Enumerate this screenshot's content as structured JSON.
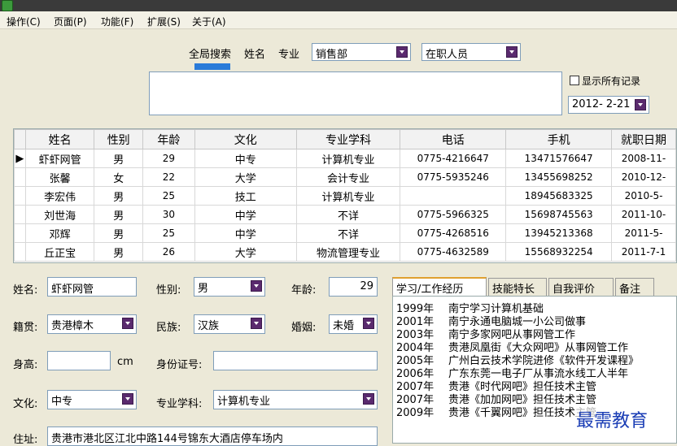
{
  "menu": [
    "操作(C)",
    "页面(P)",
    "功能(F)",
    "扩展(S)",
    "关于(A)"
  ],
  "search": {
    "tab_label": "全局搜索",
    "name_label": "姓名",
    "major_label": "专业",
    "dept_value": "销售部",
    "status_value": "在职人员",
    "show_all_label": "显示所有记录",
    "date_value": "2012- 2-21"
  },
  "table": {
    "columns": [
      "姓名",
      "性别",
      "年龄",
      "文化",
      "专业学科",
      "电话",
      "手机",
      "就职日期"
    ],
    "rows": [
      [
        "虾虾网管",
        "男",
        "29",
        "中专",
        "计算机专业",
        "0775-4216647",
        "13471576647",
        "2008-11-"
      ],
      [
        "张馨",
        "女",
        "22",
        "大学",
        "会计专业",
        "0775-5935246",
        "13455698252",
        "2010-12-"
      ],
      [
        "李宏伟",
        "男",
        "25",
        "技工",
        "计算机专业",
        "",
        "18945683325",
        "2010-5-"
      ],
      [
        "刘世海",
        "男",
        "30",
        "中学",
        "不详",
        "0775-5966325",
        "15698745563",
        "2011-10-"
      ],
      [
        "邓辉",
        "男",
        "25",
        "中学",
        "不详",
        "0775-4268516",
        "13945213368",
        "2011-5-"
      ],
      [
        "丘正宝",
        "男",
        "26",
        "大学",
        "物流管理专业",
        "0775-4632589",
        "15568932254",
        "2011-7-1"
      ]
    ]
  },
  "detail": {
    "name_label": "姓名:",
    "name_value": "虾虾网管",
    "gender_label": "性别:",
    "gender_value": "男",
    "age_label": "年龄:",
    "age_value": "29",
    "native_label": "籍贯:",
    "native_value": "贵港樟木",
    "ethnic_label": "民族:",
    "ethnic_value": "汉族",
    "marital_label": "婚姻:",
    "marital_value": "未婚",
    "height_label": "身高:",
    "height_unit": "cm",
    "id_label": "身份证号:",
    "edu_label": "文化:",
    "edu_value": "中专",
    "major_label": "专业学科:",
    "major_value": "计算机专业",
    "address_label": "住址:",
    "address_value": "贵港市港北区江北中路144号锦东大酒店停车场内"
  },
  "tabs": [
    "学习/工作经历",
    "技能特长",
    "自我评价",
    "备注"
  ],
  "history": [
    {
      "year": "1999年",
      "text": "南宁学习计算机基础"
    },
    {
      "year": "2001年",
      "text": "南宁永通电脑城一小公司做事"
    },
    {
      "year": "2003年",
      "text": "南宁多家网吧从事网管工作"
    },
    {
      "year": "2004年",
      "text": "贵港凤凰街《大众网吧》从事网管工作"
    },
    {
      "year": "2005年",
      "text": "广州白云技术学院进修《软件开发课程》"
    },
    {
      "year": "2006年",
      "text": "广东东莞一电子厂从事流水线工人半年"
    },
    {
      "year": "2007年",
      "text": "贵港《时代网吧》担任技术主管"
    },
    {
      "year": "2007年",
      "text": "贵港《加加网吧》担任技术主管"
    },
    {
      "year": "2009年",
      "text": "贵港《千翼网吧》担任技术主管"
    }
  ],
  "watermark": "最需教育",
  "colors": {
    "accent": "#2a7bd9",
    "dropdown": "#5a2a6e",
    "active_tab": "#e0a030"
  }
}
